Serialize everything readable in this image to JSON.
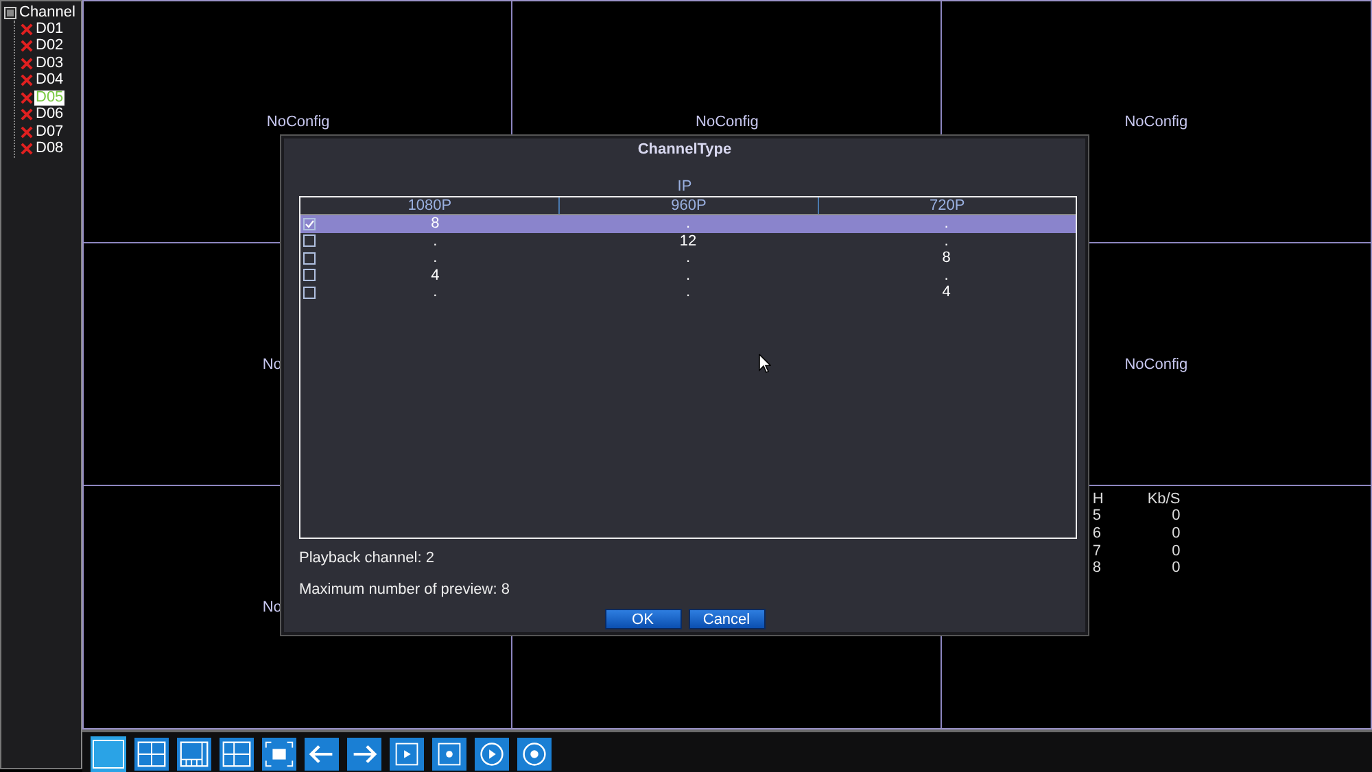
{
  "sidebar": {
    "label": "Channel",
    "checked": true,
    "children": [
      {
        "label": "D01",
        "selected": false
      },
      {
        "label": "D02",
        "selected": false
      },
      {
        "label": "D03",
        "selected": false
      },
      {
        "label": "D04",
        "selected": false
      },
      {
        "label": "D05",
        "selected": true
      },
      {
        "label": "D06",
        "selected": false
      },
      {
        "label": "D07",
        "selected": false
      },
      {
        "label": "D08",
        "selected": false
      }
    ]
  },
  "cells": [
    {
      "label": "NoConfig"
    },
    {
      "label": "NoConfig"
    },
    {
      "label": "NoConfig"
    },
    {
      "label": "No"
    },
    {},
    {
      "label": "NoConfig"
    },
    {
      "label": "No"
    },
    {},
    {
      "stats": {
        "columns": [
          "H",
          "Kb/S"
        ],
        "rows": [
          [
            "5",
            "0"
          ],
          [
            "6",
            "0"
          ],
          [
            "7",
            "0"
          ],
          [
            "8",
            "0"
          ]
        ]
      }
    }
  ],
  "dialog": {
    "title": "ChannelType",
    "group": "IP",
    "columns": [
      "1080P",
      "960P",
      "720P"
    ],
    "rows": [
      {
        "checked": true,
        "selected": true,
        "cells": [
          "8",
          ".",
          "."
        ]
      },
      {
        "checked": false,
        "selected": false,
        "cells": [
          ".",
          "12",
          "."
        ]
      },
      {
        "checked": false,
        "selected": false,
        "cells": [
          ".",
          ".",
          "8"
        ]
      },
      {
        "checked": false,
        "selected": false,
        "cells": [
          "4",
          ".",
          "."
        ]
      },
      {
        "checked": false,
        "selected": false,
        "cells": [
          ".",
          ".",
          "4"
        ]
      }
    ],
    "info": [
      "Playback channel: 2",
      "Maximum number of preview: 8"
    ],
    "buttons": [
      "OK",
      "Cancel"
    ]
  },
  "toolbar": [
    {
      "selected": true
    },
    {
      "selected": false
    },
    {
      "selected": false
    },
    {
      "selected": false
    },
    {
      "selected": false
    },
    {
      "selected": false
    },
    {
      "selected": false
    },
    {
      "selected": false
    },
    {
      "selected": false
    },
    {
      "selected": false
    },
    {
      "selected": false
    }
  ]
}
